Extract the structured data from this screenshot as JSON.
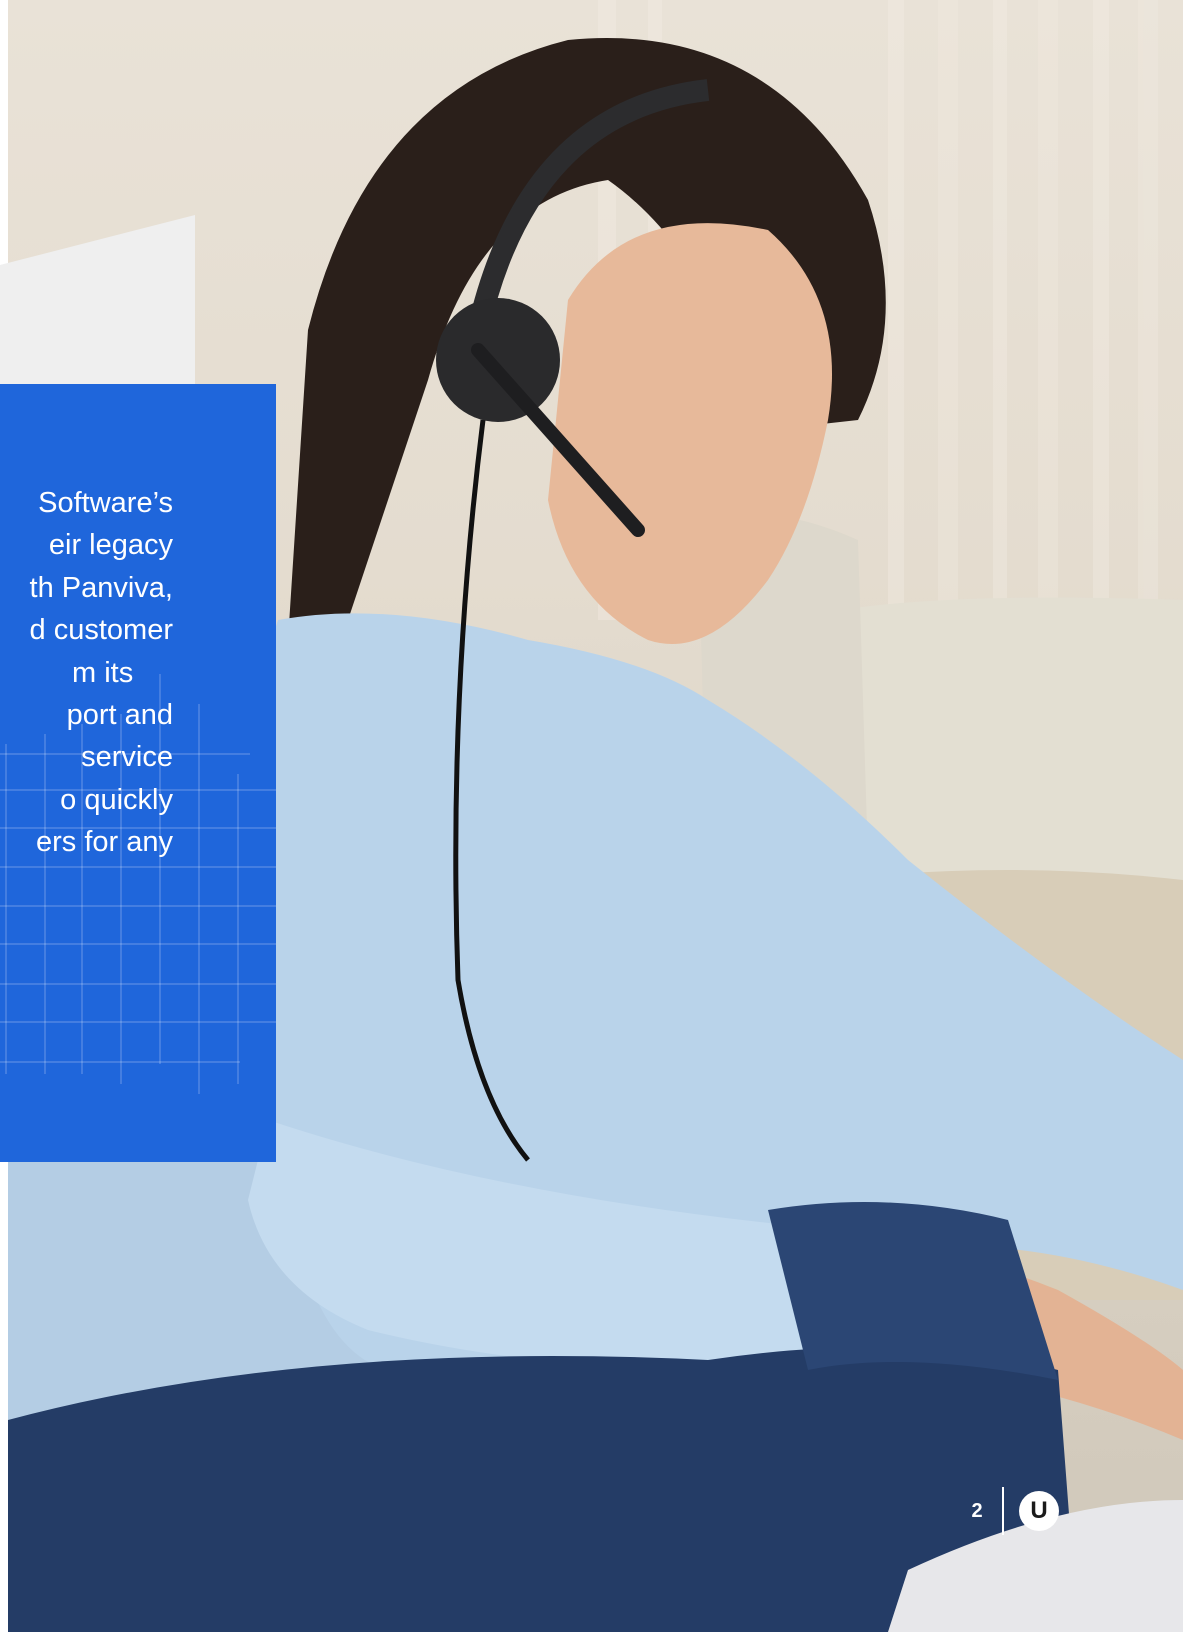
{
  "panel": {
    "lines": [
      "Software’s",
      "eir legacy",
      "th Panviva,",
      "d customer",
      "m its",
      "port and",
      " service",
      "o quickly",
      "ers for any"
    ]
  },
  "footer": {
    "page_number": "2",
    "logo_letter": "U"
  },
  "colors": {
    "panel_blue": "#1f66db",
    "grey_card": "#efefef"
  }
}
